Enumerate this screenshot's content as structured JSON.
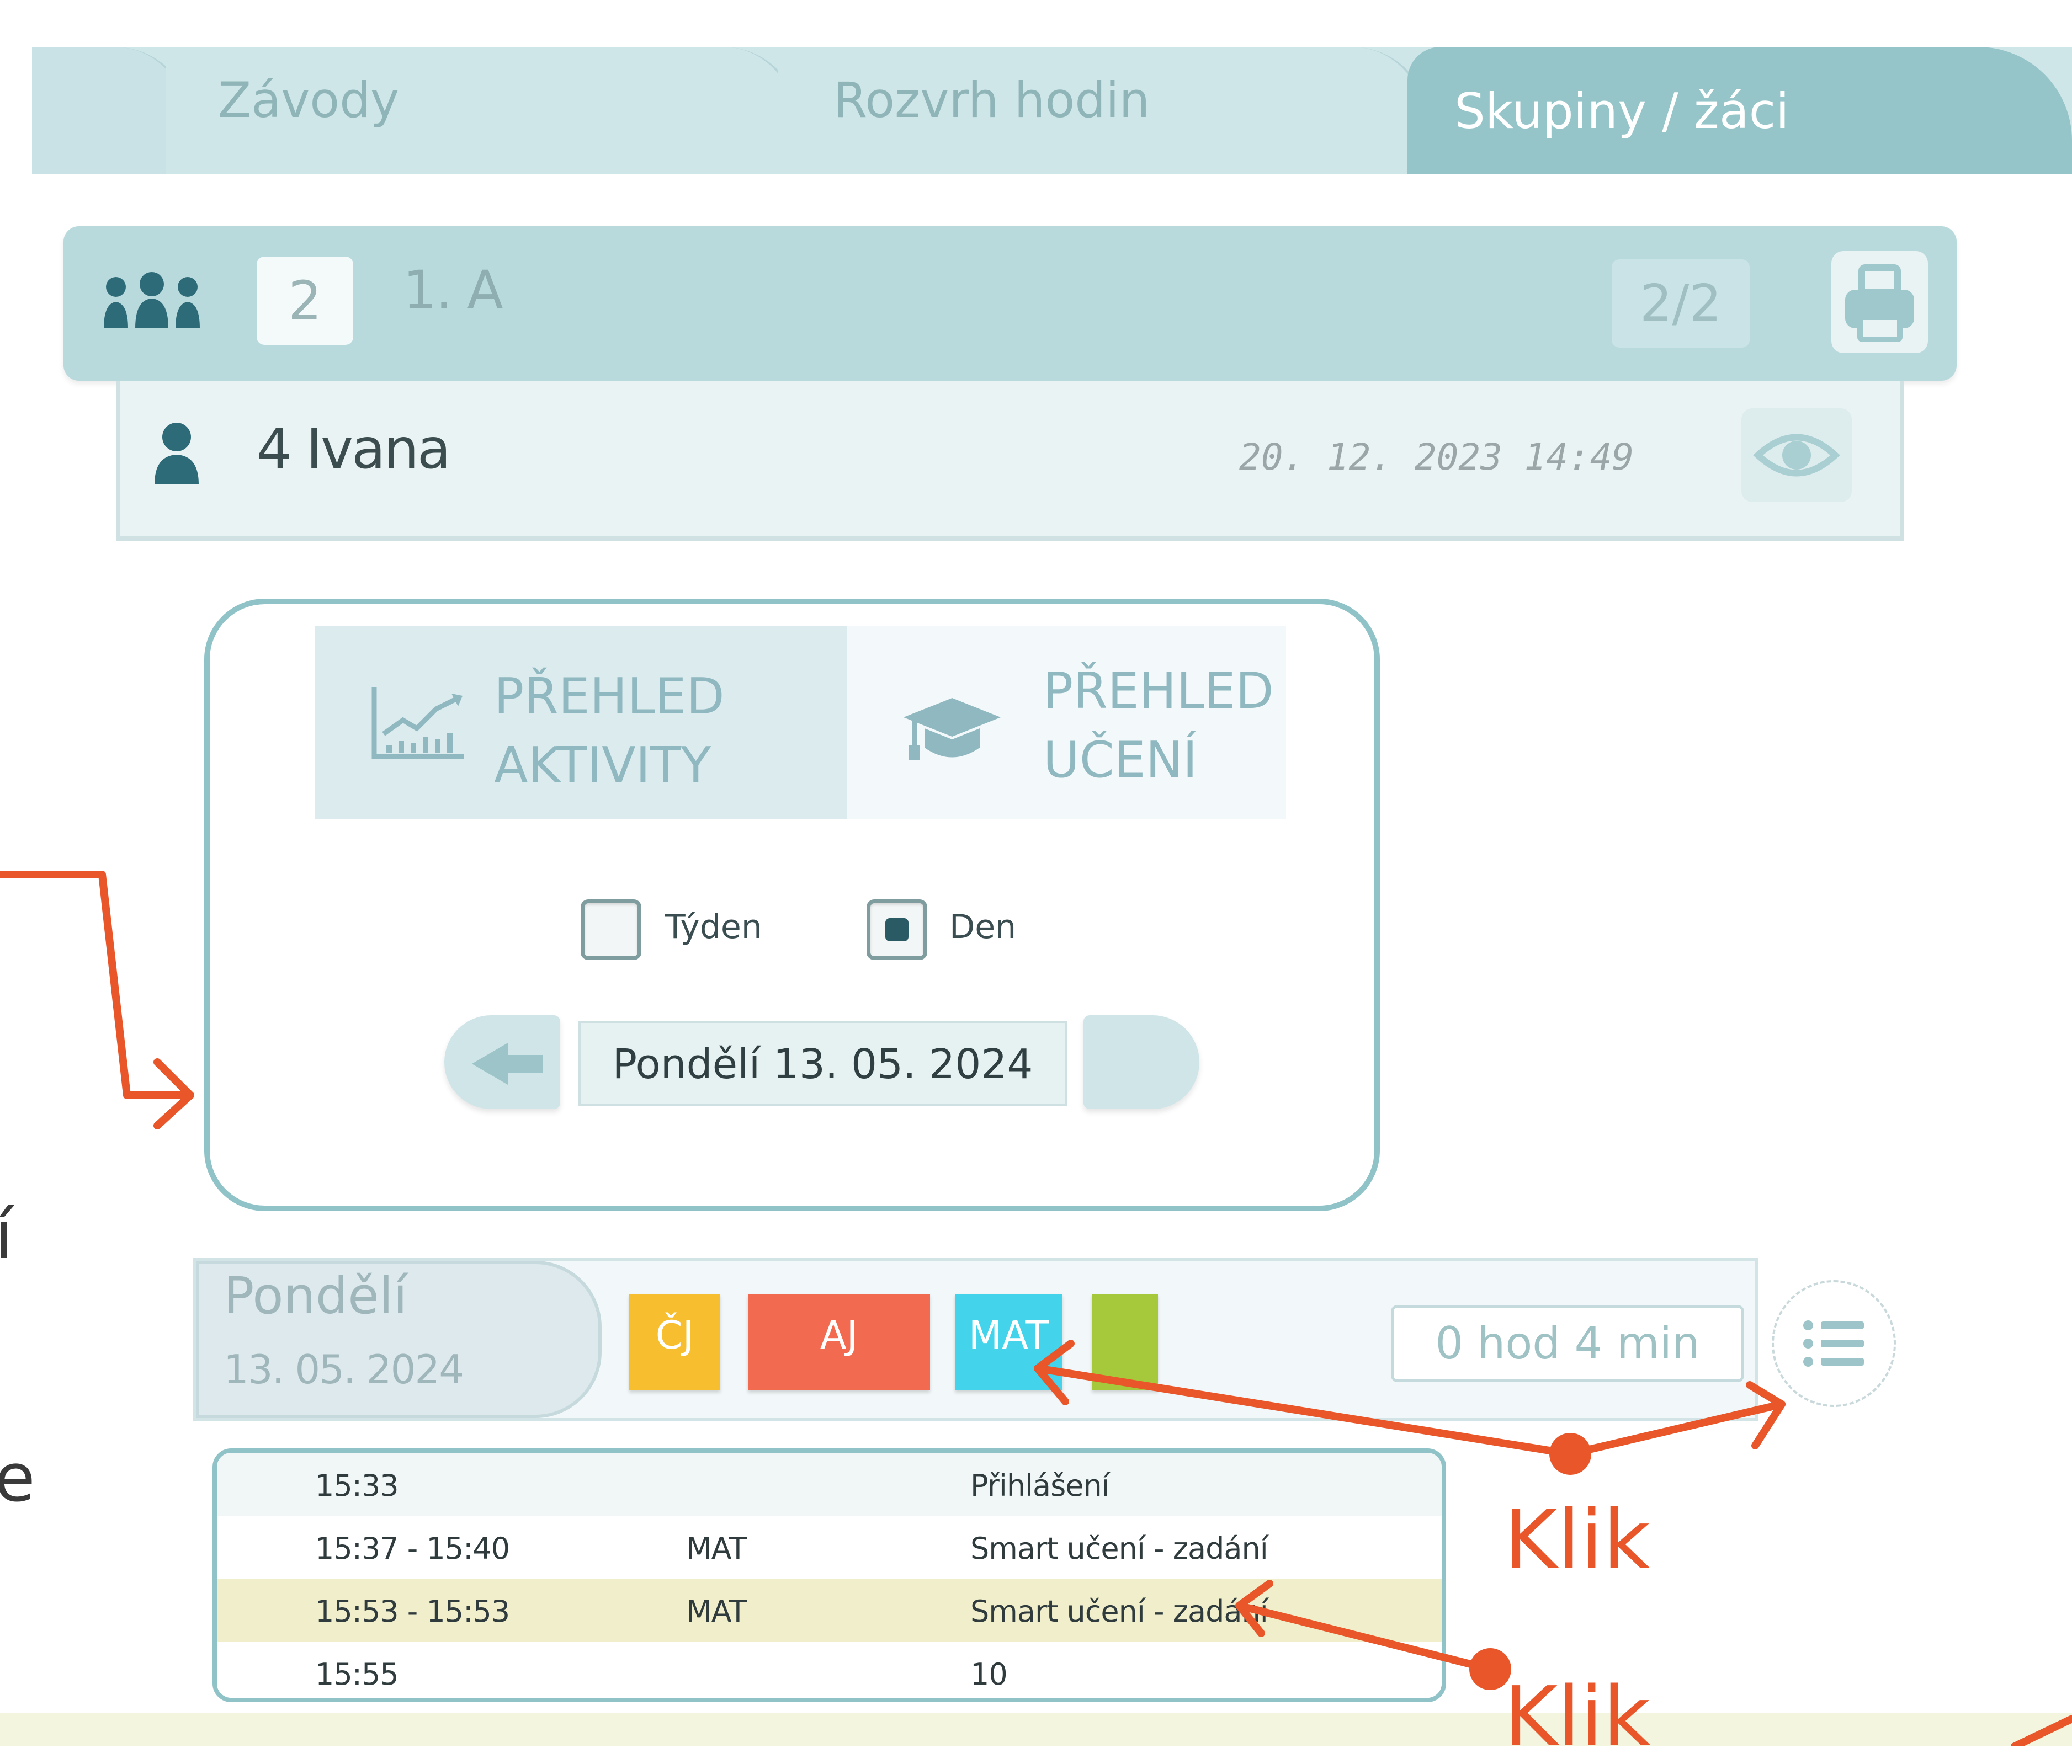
{
  "tabs": [
    {
      "label": ""
    },
    {
      "label": "Závody"
    },
    {
      "label": "Rozvrh hodin"
    },
    {
      "label": "Skupiny / žáci"
    }
  ],
  "class_bar": {
    "group_icon": "group-icon",
    "count": "2",
    "class_name": "1. A",
    "page": "2/2",
    "print_icon": "printer-icon"
  },
  "user_row": {
    "user_icon": "user-icon",
    "name": "4 Ivana",
    "timestamp": "20. 12. 2023 14:49",
    "eye_icon": "eye-icon"
  },
  "overview": {
    "tab_activity": {
      "line1": "PŘEHLED",
      "line2": "AKTIVITY",
      "icon": "chart-icon"
    },
    "tab_learning": {
      "line1": "PŘEHLED",
      "line2": "UČENÍ",
      "icon": "graduation-cap-icon"
    },
    "week_label": "Týden",
    "week_checked": false,
    "day_label": "Den",
    "day_checked": true,
    "date_value": "Pondělí 13. 05. 2024"
  },
  "day_strip": {
    "day_name": "Pondělí",
    "day_date": "13. 05. 2024",
    "subjects": [
      {
        "label": "ČJ",
        "color": "#f7bf2f"
      },
      {
        "label": "AJ",
        "color": "#f26a4f"
      },
      {
        "label": "MAT",
        "color": "#43d4ec"
      },
      {
        "label": "",
        "color": "#a6c93b"
      }
    ],
    "total_time": "0 hod 4 min",
    "list_icon": "list-icon"
  },
  "activity_table": {
    "rows": [
      {
        "time": "15:33",
        "subject": "",
        "activity": "Přihlášení",
        "highlight": false
      },
      {
        "time": "15:37 - 15:40",
        "subject": "MAT",
        "activity": "Smart učení - zadání",
        "highlight": false
      },
      {
        "time": "15:53 - 15:53",
        "subject": "MAT",
        "activity": "Smart učení - zadání",
        "highlight": true
      },
      {
        "time": "15:55",
        "subject": "",
        "activity": "10",
        "highlight": false
      }
    ]
  },
  "annotations": {
    "klik1": "Klik",
    "klik2": "Klik",
    "side_char1": "í",
    "side_char2": "e",
    "arrow_color": "#e8562a"
  },
  "colors": {
    "accent_teal": "#8fc3c7",
    "active_tab": "#95c5c9",
    "highlight_row": "#f0eecb"
  }
}
